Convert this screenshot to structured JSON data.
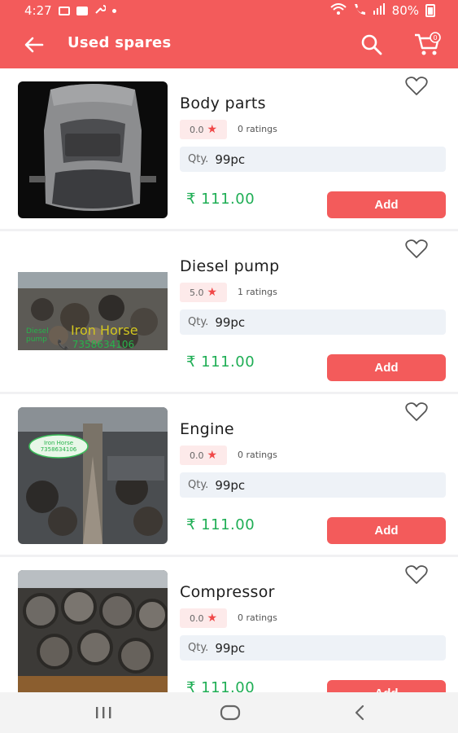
{
  "status_bar": {
    "time": "4:27",
    "battery": "80%"
  },
  "app_bar": {
    "title": "Used spares",
    "back_icon": "arrow-left-icon",
    "search_icon": "search-icon",
    "cart_icon": "cart-icon",
    "cart_badge": "0"
  },
  "products": [
    {
      "name": "Body parts",
      "rating": "0.0",
      "ratings_text": "0 ratings",
      "qty_label": "Qty.",
      "qty_value": "99pc",
      "price": "₹ 111.00",
      "add_label": "Add",
      "image": "car-body-photo"
    },
    {
      "name": "Diesel pump",
      "rating": "5.0",
      "ratings_text": "1 ratings",
      "qty_label": "Qty.",
      "qty_value": "99pc",
      "price": "₹ 111.00",
      "add_label": "Add",
      "image": "diesel-pump-photo",
      "image_text": {
        "line1": "Diesel",
        "line2": "pump",
        "brand": "Iron Horse",
        "phone": "7358634106"
      }
    },
    {
      "name": "Engine",
      "rating": "0.0",
      "ratings_text": "0 ratings",
      "qty_label": "Qty.",
      "qty_value": "99pc",
      "price": "₹ 111.00",
      "add_label": "Add",
      "image": "engine-warehouse-photo",
      "image_text": {
        "brand": "Iron Horse",
        "phone": "7358634106"
      }
    },
    {
      "name": "Compressor",
      "rating": "0.0",
      "ratings_text": "0 ratings",
      "qty_label": "Qty.",
      "qty_value": "99pc",
      "price": "₹ 111.00",
      "add_label": "Add",
      "image": "compressor-photo"
    }
  ],
  "colors": {
    "primary": "#f35b5b",
    "price_green": "#1fae55",
    "rating_bg": "#fdeaea",
    "qty_bg": "#eef2f7"
  },
  "nav_bar": {
    "recents_icon": "recents-icon",
    "home_icon": "home-icon",
    "back_icon": "nav-back-icon"
  }
}
